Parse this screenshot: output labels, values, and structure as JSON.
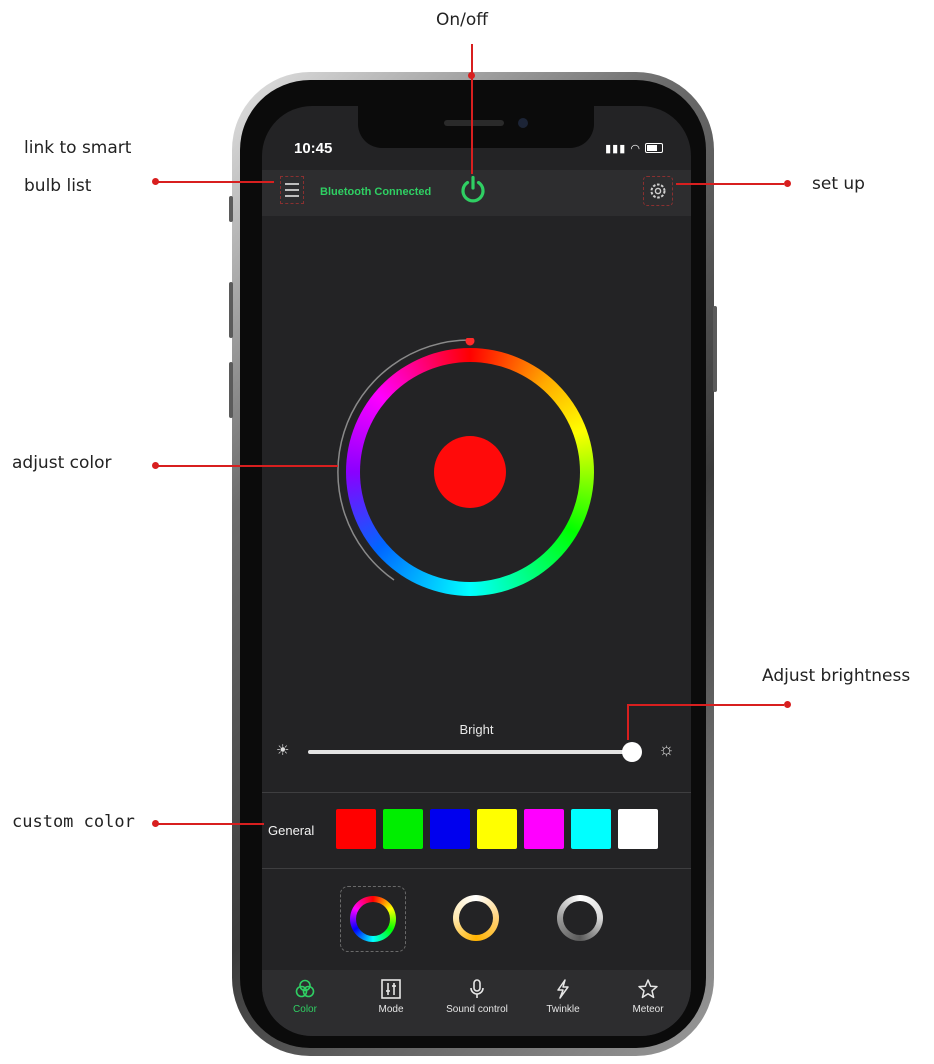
{
  "annotations": {
    "on_off": "On/off",
    "bulb_list_line1": "link to smart",
    "bulb_list_line2": "bulb list",
    "set_up": "set up",
    "adjust_color": "adjust color",
    "adjust_brightness": "Adjust brightness",
    "custom_color": "custom color"
  },
  "status_bar": {
    "time": "10:45"
  },
  "header": {
    "connection_status": "Bluetooth Connected",
    "menu_icon": "bulb-list-icon",
    "power_icon": "power-icon",
    "settings_icon": "gear-icon"
  },
  "color_wheel": {
    "selected_color": "#ff0a0a"
  },
  "brightness": {
    "label": "Bright",
    "value_fraction": 1.0
  },
  "custom_colors": {
    "label": "General",
    "swatches": [
      "#ff0000",
      "#00ee00",
      "#0000ee",
      "#ffff00",
      "#ff00ff",
      "#00ffff",
      "#ffffff"
    ]
  },
  "ring_modes": [
    "rainbow-ring",
    "warm-ring",
    "white-ring"
  ],
  "tabs": [
    {
      "label": "Color",
      "icon": "color-icon",
      "active": true
    },
    {
      "label": "Mode",
      "icon": "mode-icon",
      "active": false
    },
    {
      "label": "Sound control",
      "icon": "microphone-icon",
      "active": false
    },
    {
      "label": "Twinkle",
      "icon": "twinkle-icon",
      "active": false
    },
    {
      "label": "Meteor",
      "icon": "star-icon",
      "active": false
    }
  ],
  "colors": {
    "accent_green": "#2fcf63",
    "annotation_red": "#d81f1f"
  }
}
